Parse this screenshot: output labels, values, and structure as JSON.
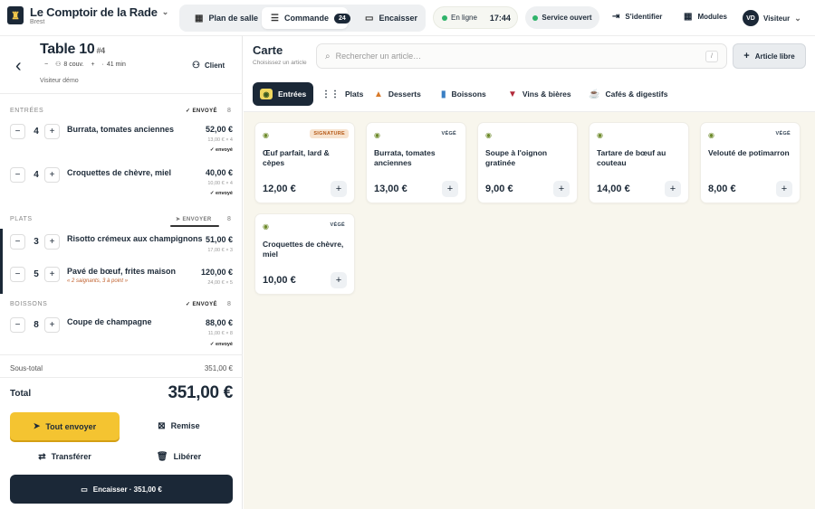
{
  "brand": {
    "name": "Le Comptoir de la Rade",
    "city": "Brest"
  },
  "nav": {
    "floor_plan": "Plan de salle",
    "order": "Commande",
    "order_count": "24",
    "checkout": "Encaisser"
  },
  "status": {
    "online": "En ligne",
    "time": "17:44",
    "service": "Service ouvert"
  },
  "actions": {
    "login": "S'identifier",
    "modules": "Modules",
    "avatar": "VD",
    "user": "Visiteur"
  },
  "table": {
    "name": "Table 10",
    "number": "#4",
    "covers": "8 couv.",
    "minutes": "41 min",
    "user": "Visiteur démo",
    "client_label": "Client"
  },
  "sections": [
    {
      "label": "ENTRÉES",
      "status": "ENVOYÉ",
      "count": "8"
    },
    {
      "label": "PLATS",
      "status": "ENVOYER",
      "count": "8"
    },
    {
      "label": "BOISSONS",
      "status": "ENVOYÉ",
      "count": "8"
    }
  ],
  "lines": [
    {
      "qty": "4",
      "name": "Burrata, tomates anciennes",
      "note": "",
      "price": "52,00 €",
      "unit": "13,00 € × 4",
      "sent": "envoyé"
    },
    {
      "qty": "4",
      "name": "Croquettes de chèvre, miel",
      "note": "",
      "price": "40,00 €",
      "unit": "10,00 € × 4",
      "sent": "envoyé"
    },
    {
      "qty": "3",
      "name": "Risotto crémeux aux champignons",
      "note": "",
      "price": "51,00 €",
      "unit": "17,00 € × 3",
      "sent": ""
    },
    {
      "qty": "5",
      "name": "Pavé de bœuf, frites maison",
      "note": "« 2 saignants, 3 à point »",
      "price": "120,00 €",
      "unit": "24,00 € × 5",
      "sent": ""
    },
    {
      "qty": "8",
      "name": "Coupe de champagne",
      "note": "",
      "price": "88,00 €",
      "unit": "11,00 € × 8",
      "sent": "envoyé"
    }
  ],
  "summary": {
    "subtotal_label": "Sous-total",
    "subtotal": "351,00 €",
    "total_label": "Total",
    "total": "351,00 €"
  },
  "buttons": {
    "send_all": "Tout envoyer",
    "discount": "Remise",
    "transfer": "Transférer",
    "release": "Libérer",
    "pay": "Encaisser · 351,00 €"
  },
  "menu": {
    "title": "Carte",
    "subtitle": "Choisissez un article",
    "search_placeholder": "Rechercher un article…",
    "shortcut": "/",
    "free_item": "Article libre"
  },
  "categories": [
    {
      "label": "Entrées",
      "icon": "salad-icon"
    },
    {
      "label": "Plats",
      "icon": "cutlery-icon"
    },
    {
      "label": "Desserts",
      "icon": "cake-icon"
    },
    {
      "label": "Boissons",
      "icon": "cup-icon"
    },
    {
      "label": "Vins & bières",
      "icon": "wine-icon"
    },
    {
      "label": "Cafés & digestifs",
      "icon": "coffee-icon"
    }
  ],
  "products": [
    {
      "name": "Œuf parfait, lard & cèpes",
      "price": "12,00 €",
      "tag": "SIGNATURE"
    },
    {
      "name": "Burrata, tomates anciennes",
      "price": "13,00 €",
      "tag": "VÉGÉ"
    },
    {
      "name": "Soupe à l'oignon gratinée",
      "price": "9,00 €",
      "tag": ""
    },
    {
      "name": "Tartare de bœuf au couteau",
      "price": "14,00 €",
      "tag": ""
    },
    {
      "name": "Velouté de potimarron",
      "price": "8,00 €",
      "tag": "VÉGÉ"
    },
    {
      "name": "Croquettes de chèvre, miel",
      "price": "10,00 €",
      "tag": "VÉGÉ"
    }
  ],
  "colors": {
    "navy": "#1b2837",
    "accent": "#f4c431",
    "online": "#2fb36a",
    "background": "#f8f6ed"
  }
}
